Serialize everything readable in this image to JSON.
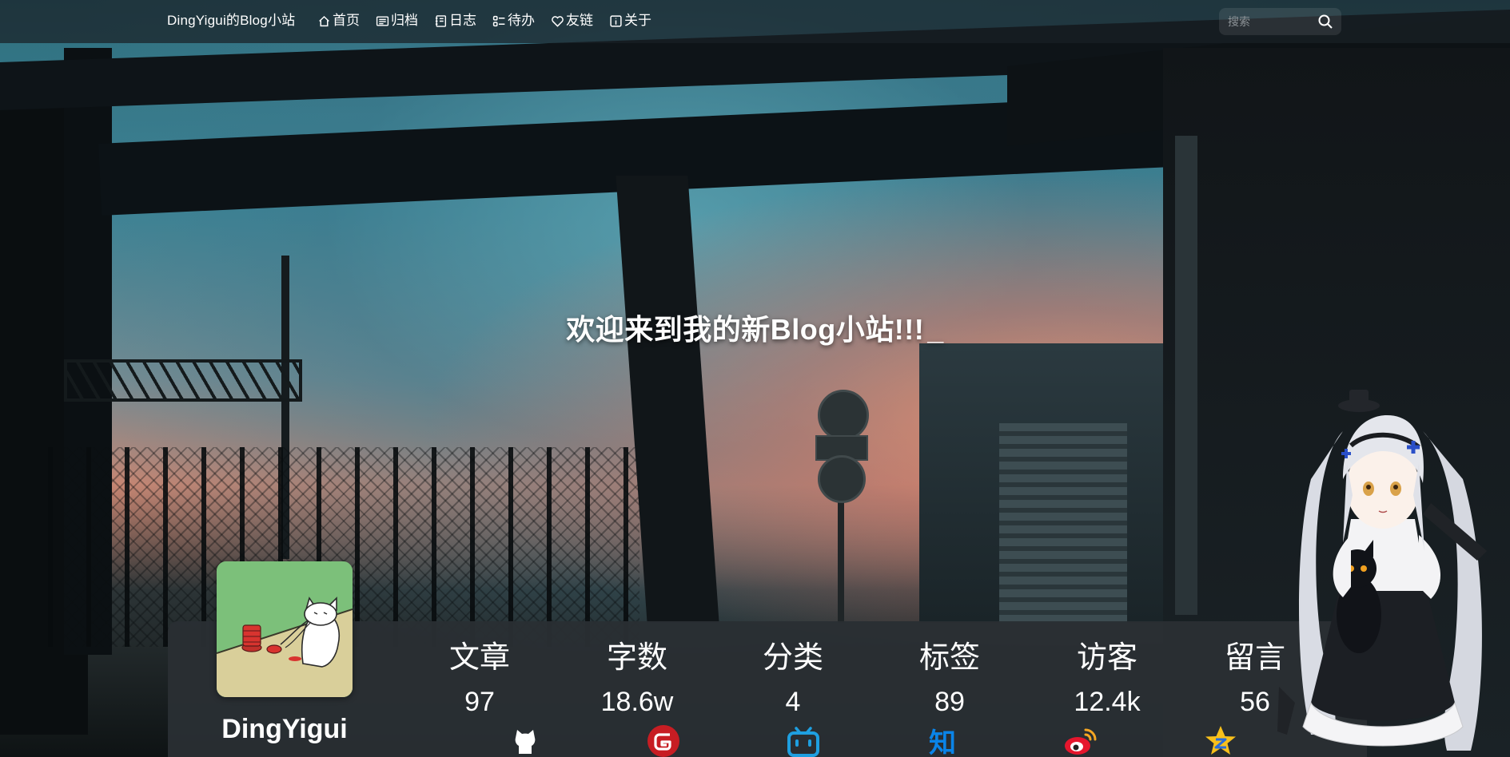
{
  "brand": {
    "title": "DingYigui的Blog小站"
  },
  "nav": {
    "items": [
      {
        "label": "首页",
        "icon": "home-icon"
      },
      {
        "label": "归档",
        "icon": "archive-icon"
      },
      {
        "label": "日志",
        "icon": "journal-icon"
      },
      {
        "label": "待办",
        "icon": "todo-icon"
      },
      {
        "label": "友链",
        "icon": "heart-icon"
      },
      {
        "label": "关于",
        "icon": "info-icon"
      }
    ]
  },
  "search": {
    "placeholder": "搜索",
    "icon": "search-icon"
  },
  "hero": {
    "headline": "欢迎来到我的新Blog小站!!!",
    "cursor": "_"
  },
  "profile": {
    "name": "DingYigui",
    "avatar_icon": "cat-avatar"
  },
  "stats": [
    {
      "label": "文章",
      "value": "97"
    },
    {
      "label": "字数",
      "value": "18.6w"
    },
    {
      "label": "分类",
      "value": "4"
    },
    {
      "label": "标签",
      "value": "89"
    },
    {
      "label": "访客",
      "value": "12.4k"
    },
    {
      "label": "留言",
      "value": "56"
    }
  ],
  "social": [
    {
      "name": "github",
      "icon": "github-icon",
      "color": "#ffffff"
    },
    {
      "name": "gitee",
      "icon": "gitee-icon",
      "color": "#c71d23"
    },
    {
      "name": "bilibili",
      "icon": "bilibili-icon",
      "color": "#1e9fe0"
    },
    {
      "name": "zhihu",
      "icon": "zhihu-icon",
      "color": "#0a84e8"
    },
    {
      "name": "weibo",
      "icon": "weibo-icon",
      "color": "#e6162d"
    },
    {
      "name": "qzone",
      "icon": "qzone-icon",
      "color": "#f8c01b"
    }
  ],
  "colors": {
    "navbar_bg": "#192026",
    "card_bg": "#2a2f33",
    "text": "#ffffff",
    "sunset": "#f5916e",
    "sky": "#3e8596"
  }
}
